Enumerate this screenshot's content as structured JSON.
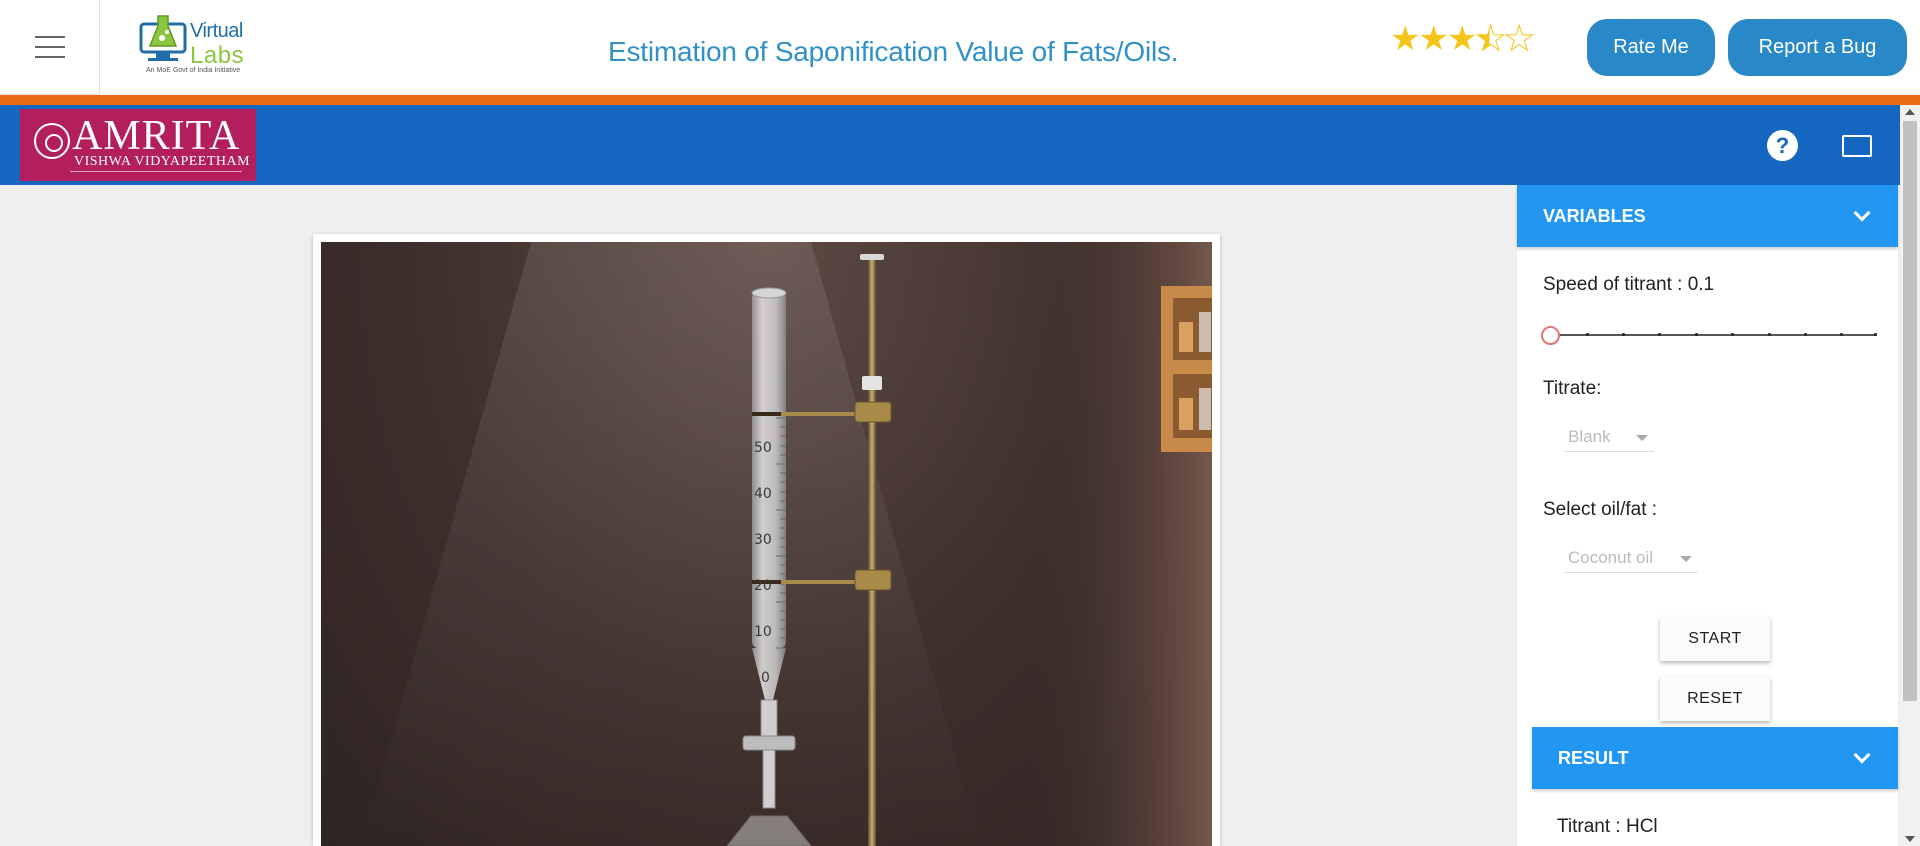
{
  "header": {
    "logo_word1": "Virtual",
    "logo_word2": "Labs",
    "logo_tagline": "An MoE Govt of India Initiative",
    "title": "Estimation of Saponification Value of Fats/Oils.",
    "rating": 3.5,
    "rating_max": 5,
    "rate_label": "Rate Me",
    "bug_label": "Report a Bug"
  },
  "toolbar": {
    "amrita_name": "AMRITA",
    "amrita_sub": "VISHWA VIDYAPEETHAM",
    "help_glyph": "?"
  },
  "simulation": {
    "burette_ticks": [
      "50",
      "40",
      "30",
      "20",
      "10",
      "0"
    ]
  },
  "panel": {
    "variables_header": "VARIABLES",
    "speed_label": "Speed of titrant : 0.1",
    "speed_value": 0.1,
    "titrate_label": "Titrate:",
    "titrate_value": "Blank",
    "oil_label": "Select oil/fat :",
    "oil_value": "Coconut oil",
    "start_label": "START",
    "reset_label": "RESET",
    "result_header": "RESULT",
    "titrant_text": "Titrant : HCl"
  },
  "colors": {
    "accent_orange": "#ea6b12",
    "toolbar_blue": "#1566c1",
    "panel_blue": "#2196f3",
    "button_blue": "#2988c8",
    "amrita_red": "#b31f5c"
  }
}
